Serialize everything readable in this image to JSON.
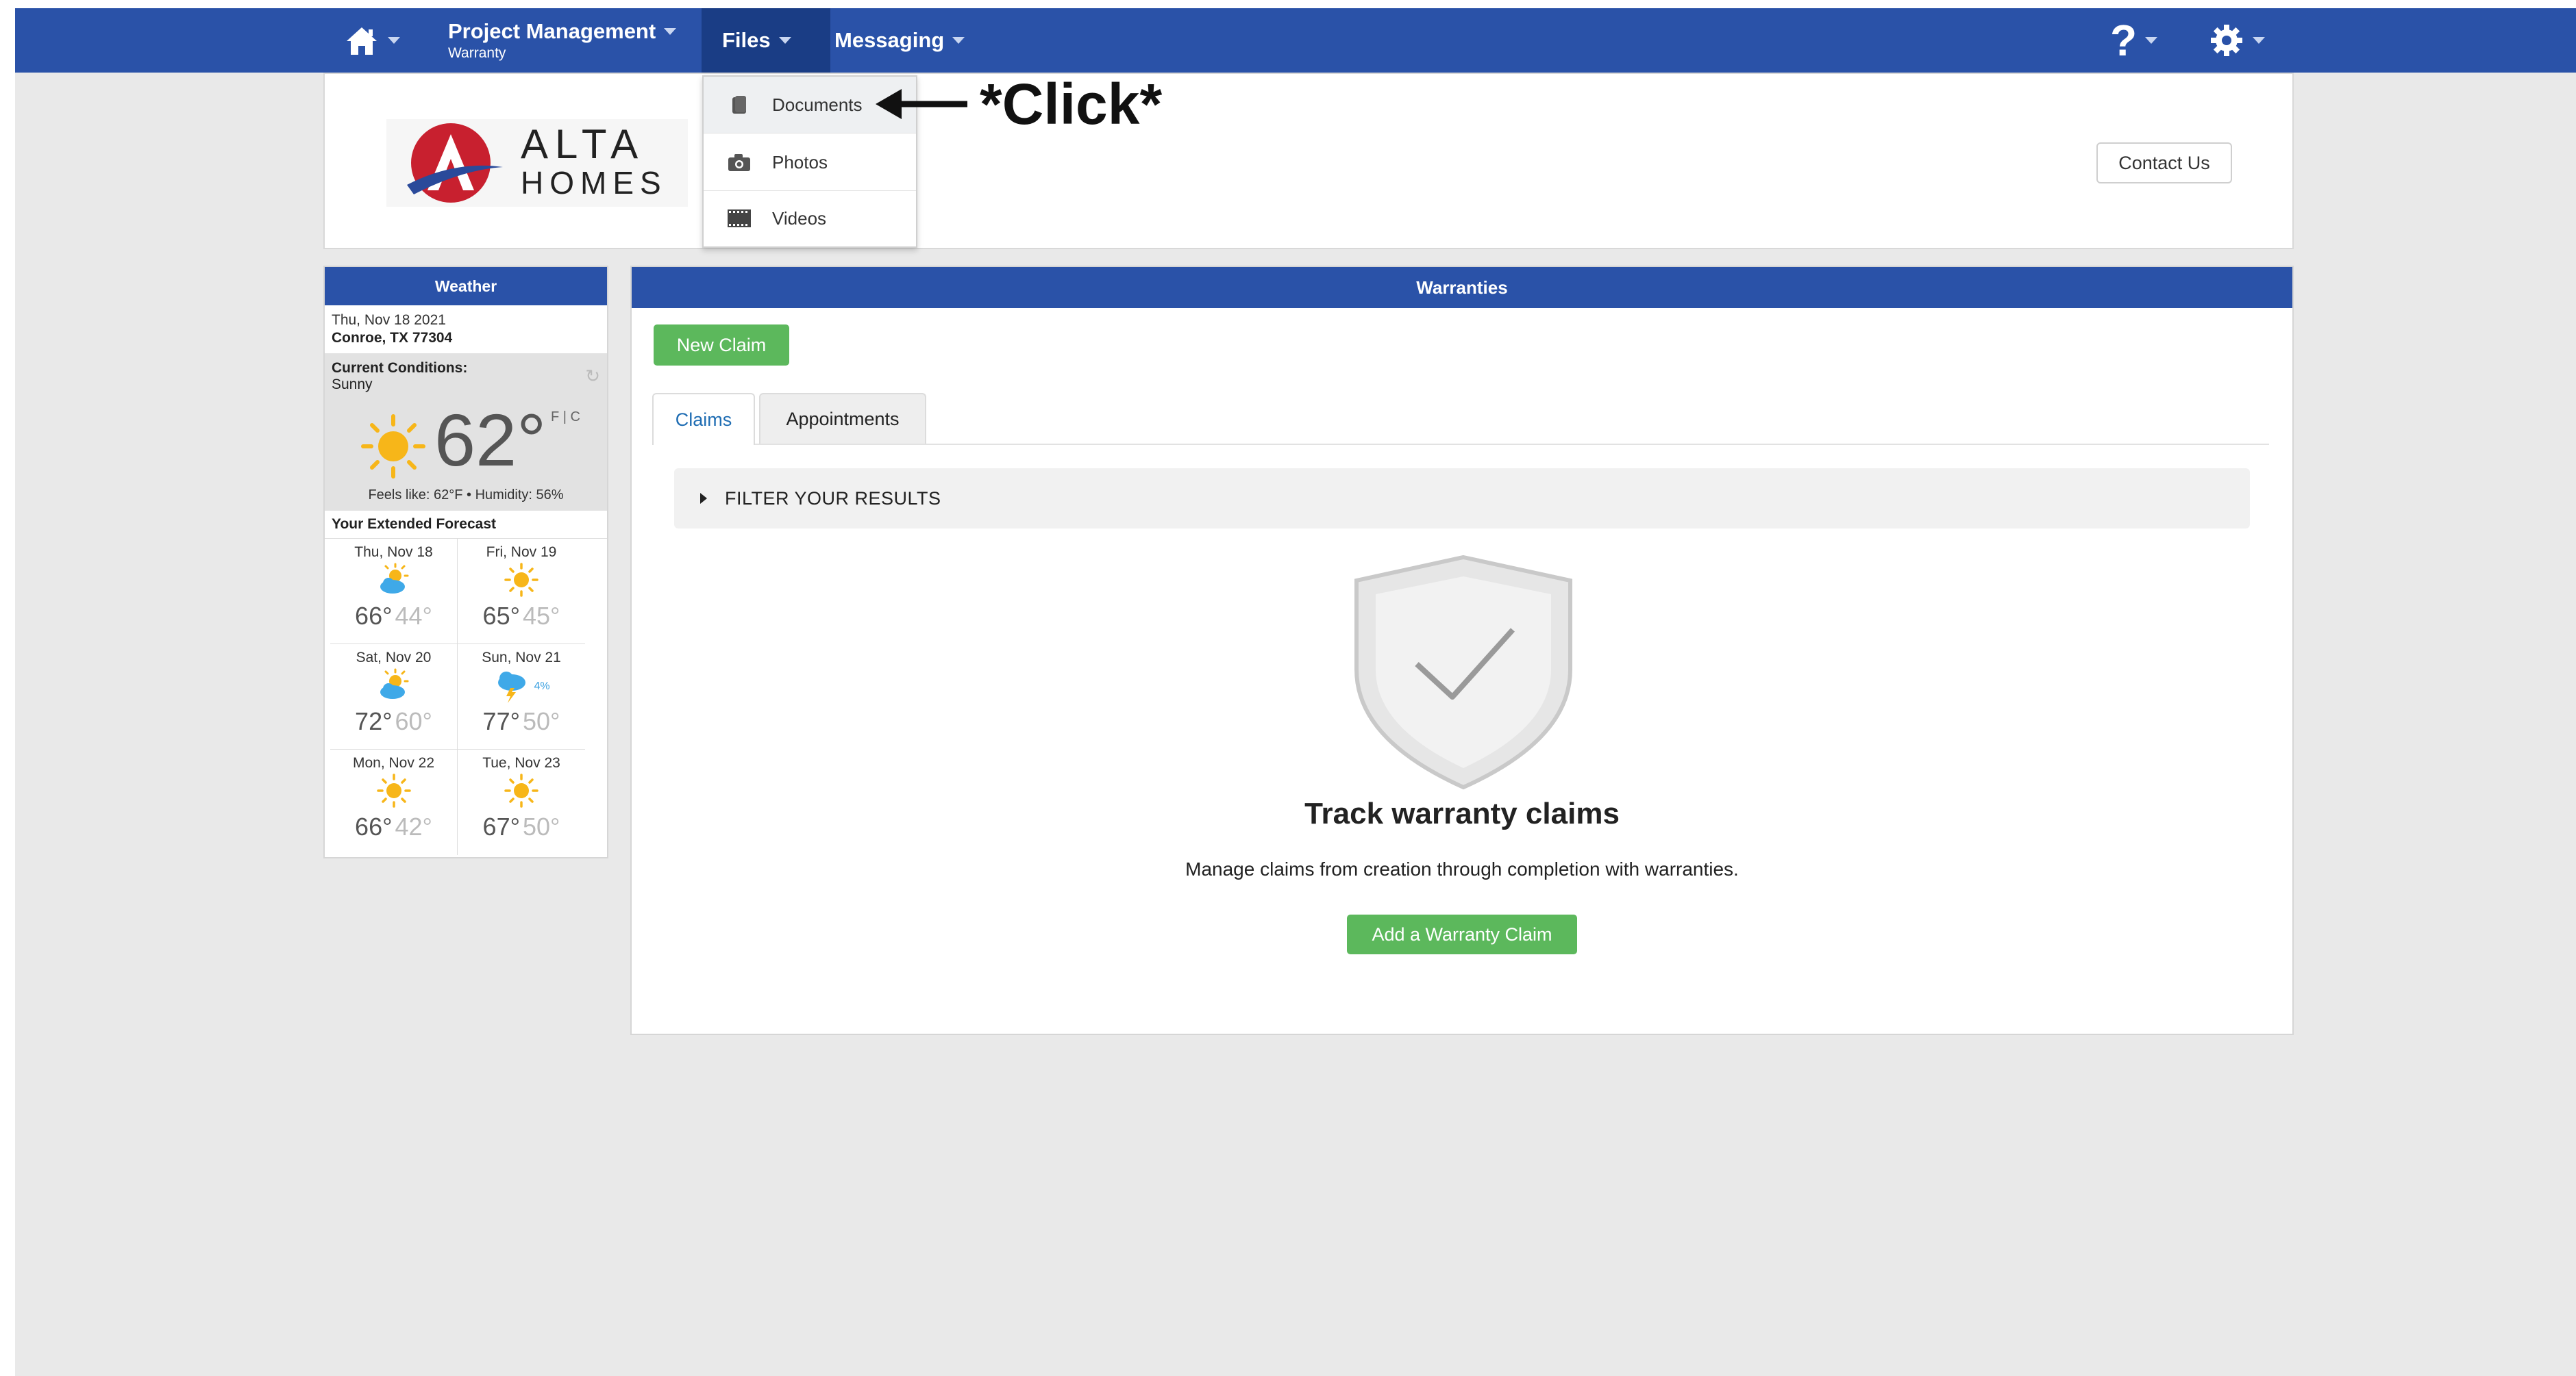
{
  "nav": {
    "project_management": "Project Management",
    "project_sub": "Warranty",
    "files": "Files",
    "messaging": "Messaging"
  },
  "files_menu": {
    "items": [
      {
        "label": "Documents",
        "icon": "document-icon"
      },
      {
        "label": "Photos",
        "icon": "camera-icon"
      },
      {
        "label": "Videos",
        "icon": "film-icon"
      }
    ]
  },
  "annotation": {
    "text": "*Click*"
  },
  "header": {
    "logo_line1": "ALTA",
    "logo_line2": "HOMES",
    "contact": "Contact Us"
  },
  "weather": {
    "title": "Weather",
    "date": "Thu, Nov 18 2021",
    "location": "Conroe, TX 77304",
    "current_label": "Current Conditions:",
    "current": "Sunny",
    "temp": "62°",
    "units": "F | C",
    "feels": "Feels like: 62°F • Humidity: 56%",
    "extended_label": "Your Extended Forecast",
    "forecast": [
      {
        "day": "Thu, Nov 18",
        "hi": "66°",
        "lo": "44°",
        "icon": "partly-cloudy-icon",
        "pop": ""
      },
      {
        "day": "Fri, Nov 19",
        "hi": "65°",
        "lo": "45°",
        "icon": "sun-icon",
        "pop": ""
      },
      {
        "day": "Sat, Nov 20",
        "hi": "72°",
        "lo": "60°",
        "icon": "partly-cloudy-icon",
        "pop": ""
      },
      {
        "day": "Sun, Nov 21",
        "hi": "77°",
        "lo": "50°",
        "icon": "thunderstorm-icon",
        "pop": "4%"
      },
      {
        "day": "Mon, Nov 22",
        "hi": "66°",
        "lo": "42°",
        "icon": "sun-icon",
        "pop": ""
      },
      {
        "day": "Tue, Nov 23",
        "hi": "67°",
        "lo": "50°",
        "icon": "sun-icon",
        "pop": ""
      }
    ]
  },
  "warranties": {
    "title": "Warranties",
    "new_claim": "New Claim",
    "tabs": [
      "Claims",
      "Appointments"
    ],
    "filter": "FILTER YOUR RESULTS",
    "empty_title": "Track warranty claims",
    "empty_desc": "Manage claims from creation through completion with warranties.",
    "add_claim": "Add a Warranty Claim"
  },
  "colors": {
    "nav_blue": "#2a52a8",
    "green": "#5cb85c",
    "link_blue": "#1f6db3"
  }
}
